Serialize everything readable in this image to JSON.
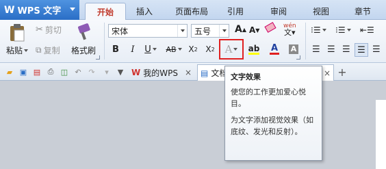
{
  "app": {
    "logo": "W",
    "name": "WPS 文字"
  },
  "tabs": [
    "开始",
    "插入",
    "页面布局",
    "引用",
    "审阅",
    "视图",
    "章节"
  ],
  "active_tab": "开始",
  "clipboard": {
    "paste": "粘贴",
    "cut": "剪切",
    "copy": "复制",
    "format_painter": "格式刷"
  },
  "font": {
    "name": "宋体",
    "size": "五号"
  },
  "font_buttons": {
    "grow": "A",
    "shrink": "A",
    "bold": "B",
    "italic": "I",
    "underline": "U",
    "strikethrough": "AB",
    "superscript": "X",
    "subscript": "X",
    "text_effect": "A",
    "highlight": "ab",
    "font_color": "A",
    "char_shading": "A",
    "phonetic": "wén"
  },
  "quick_access": {
    "doc_tabs": [
      "我的WPS",
      "文档"
    ]
  },
  "tooltip": {
    "title": "文字效果",
    "line1": "使您的工作更加爱心悦目。",
    "line2": "为文字添加视觉效果（如底纹、发光和反射）。"
  },
  "colors": {
    "accent_tab": "#c0392b",
    "app_button": "#2a6ec6",
    "highlight_box": "#e02020"
  }
}
